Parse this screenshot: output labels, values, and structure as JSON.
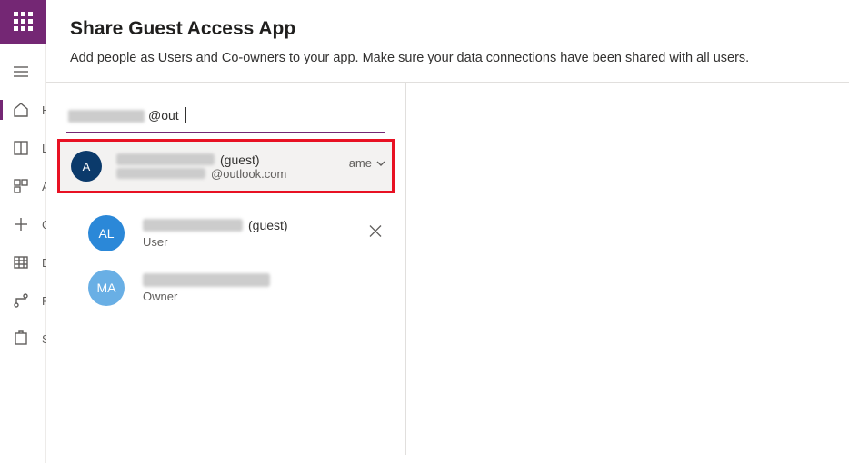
{
  "header": {
    "title": "Share Guest Access App",
    "subtitle": "Add people as Users and Co-owners to your app. Make sure your data connections have been shared with all users."
  },
  "sidebar": {
    "items": [
      {
        "name": "hamburger",
        "label": ""
      },
      {
        "name": "home",
        "label": "H"
      },
      {
        "name": "learn",
        "label": "L"
      },
      {
        "name": "apps",
        "label": "A"
      },
      {
        "name": "create",
        "label": "C"
      },
      {
        "name": "data",
        "label": "D"
      },
      {
        "name": "flows",
        "label": "F"
      },
      {
        "name": "solutions",
        "label": "S"
      }
    ]
  },
  "search": {
    "visible_text": "@out"
  },
  "suggestion": {
    "avatar_initials": "A",
    "name_suffix": "(guest)",
    "email_suffix": "@outlook.com"
  },
  "sort": {
    "label_fragment": "ame"
  },
  "people": [
    {
      "avatar_initials": "AL",
      "avatar_class": "av-blue",
      "name_suffix": "(guest)",
      "role": "User",
      "removable": true
    },
    {
      "avatar_initials": "MA",
      "avatar_class": "av-light",
      "name_suffix": "",
      "role": "Owner",
      "removable": false
    }
  ]
}
